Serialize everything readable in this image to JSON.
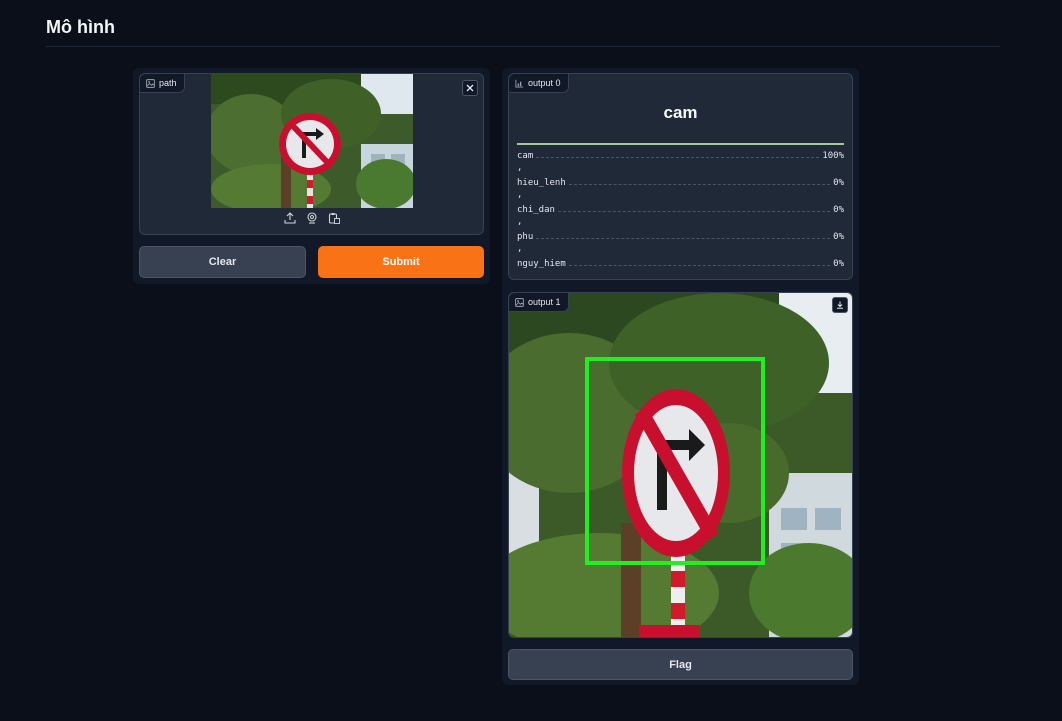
{
  "page": {
    "title": "Mô hình"
  },
  "input_panel": {
    "image_label": "path",
    "clear_label": "Clear",
    "submit_label": "Submit"
  },
  "output0": {
    "label": "output 0",
    "top_label": "cam",
    "confidences": [
      {
        "name": "cam",
        "value": "100%",
        "fraction": 1.0
      },
      {
        "name": "hieu_lenh",
        "value": "0%",
        "fraction": 0.0
      },
      {
        "name": "chi_dan",
        "value": "0%",
        "fraction": 0.0
      },
      {
        "name": "phu",
        "value": "0%",
        "fraction": 0.0
      },
      {
        "name": "nguy_hiem",
        "value": "0%",
        "fraction": 0.0
      }
    ]
  },
  "output1": {
    "label": "output 1"
  },
  "flag_label": "Flag",
  "icons": {
    "image_label_icon": "image-icon",
    "chart_label_icon": "bar-chart-icon",
    "close_icon": "close-icon",
    "upload_icon": "upload-icon",
    "webcam_icon": "webcam-icon",
    "clipboard_icon": "clipboard-icon",
    "download_icon": "download-icon"
  },
  "colors": {
    "background": "#0b0f19",
    "panel": "#111827",
    "primary_button": "#f97316",
    "secondary_button": "#374151",
    "detection_box": "#22ee22",
    "sign_red": "#c8102e"
  }
}
